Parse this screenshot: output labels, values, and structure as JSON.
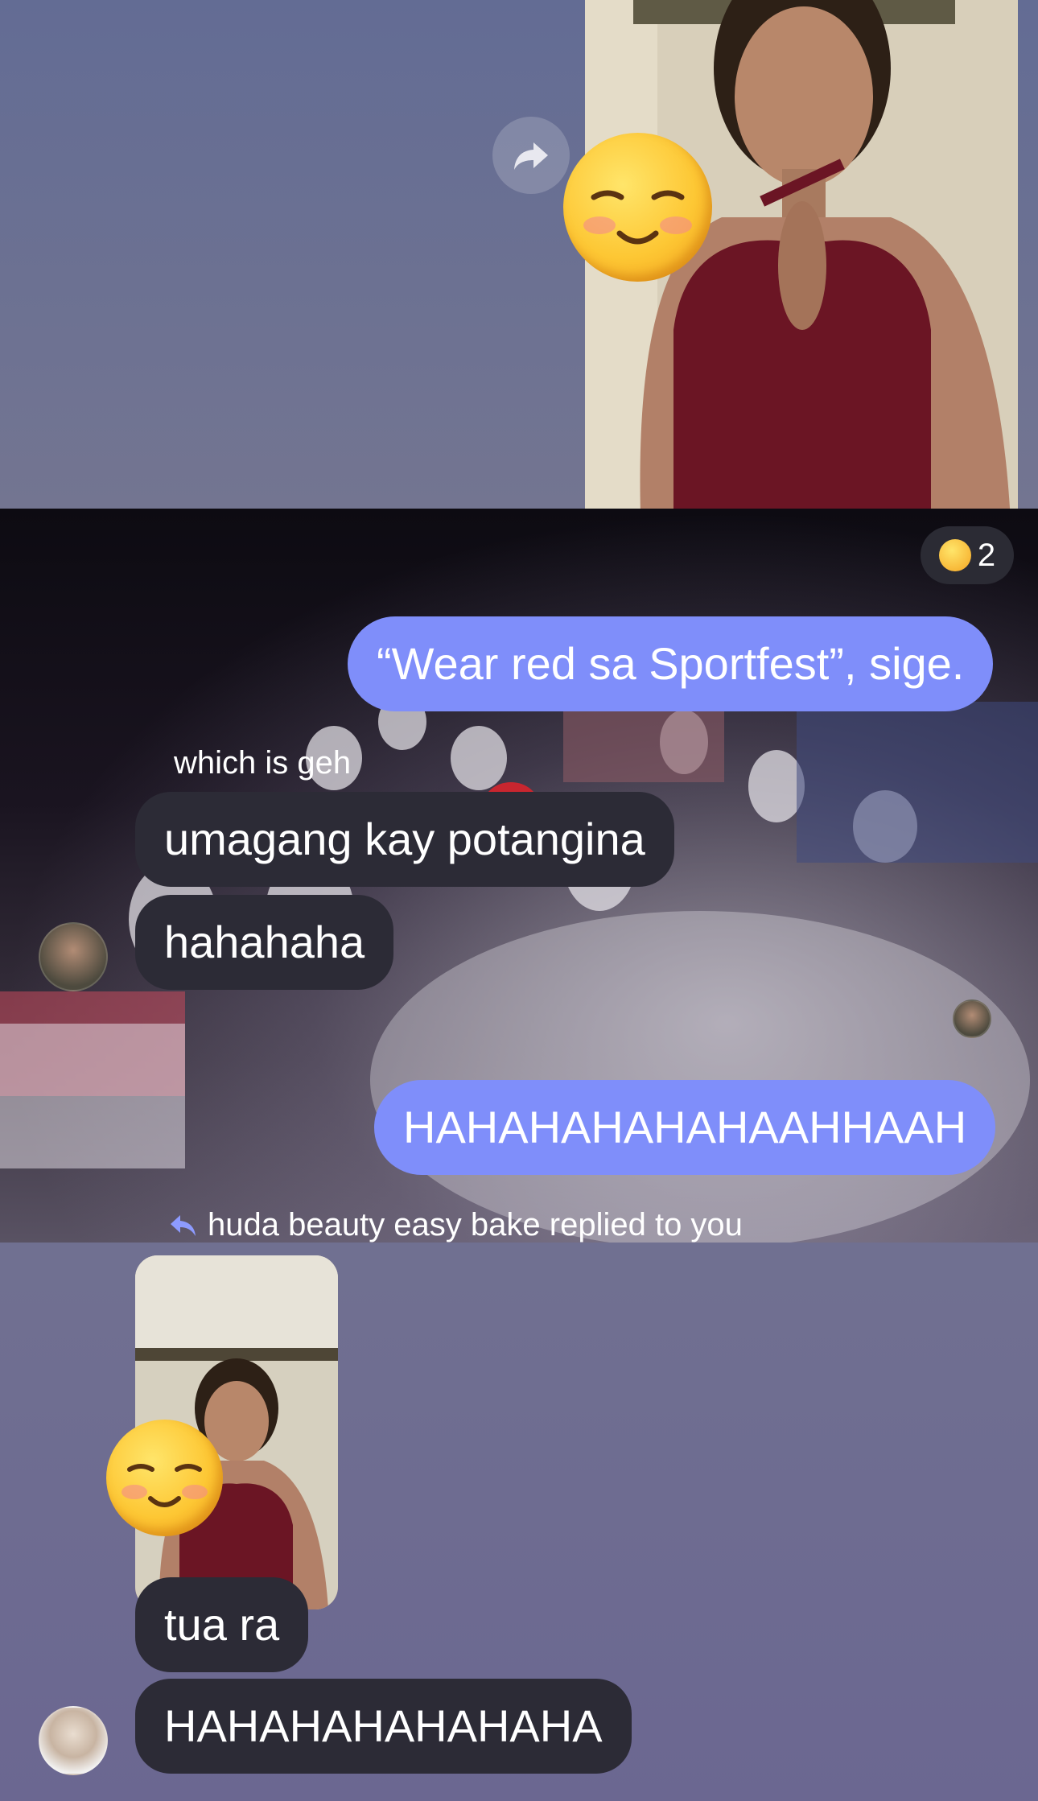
{
  "messages": {
    "reaction_count": "2",
    "outgoing_1": "“Wear red sa Sportfest”, sige.",
    "reply_caption": "which is geh",
    "incoming_1": "umagang kay potangina",
    "incoming_2": "hahahaha",
    "outgoing_2": "HAHAHAHAHAHAAHHAAH",
    "reply_note": "huda beauty easy bake replied to you",
    "incoming_3": "tua ra",
    "incoming_4": "HAHAHAHAHAHAHA"
  },
  "icons": {
    "share": "share-forward-icon",
    "reply": "reply-arrow-icon",
    "reaction": "grinning-squinting-face-emoji",
    "sticker": "smiling-face-emoji"
  },
  "colors": {
    "outgoing_bubble": "#7f8efa",
    "incoming_bubble": "#2c2b36",
    "reply_arrow": "#8d9bff"
  }
}
